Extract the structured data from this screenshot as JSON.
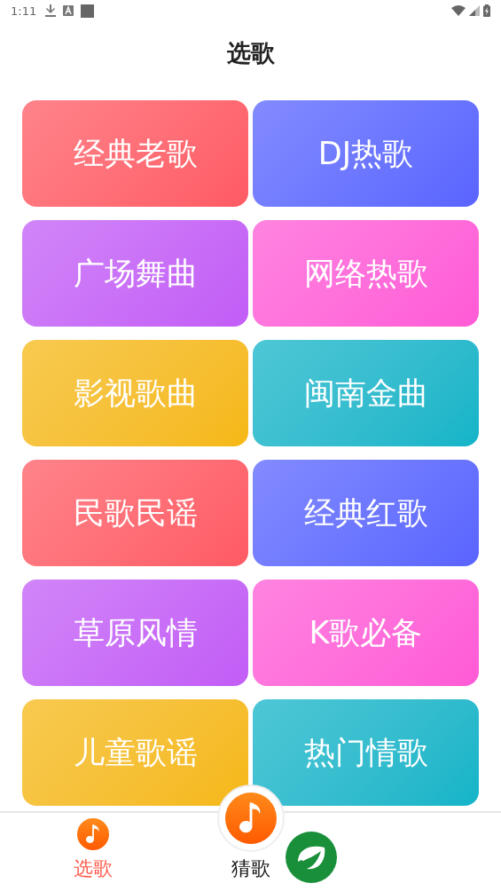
{
  "status_bar": {
    "time": "1:11"
  },
  "title": "选歌",
  "tiles": [
    {
      "label": "经典老歌",
      "color": "#ff5a64"
    },
    {
      "label": "DJ热歌",
      "color": "#5a64ff"
    },
    {
      "label": "广场舞曲",
      "color": "#c25cf6"
    },
    {
      "label": "网络热歌",
      "color": "#ff5ad6"
    },
    {
      "label": "影视歌曲",
      "color": "#f5b814"
    },
    {
      "label": "闽南金曲",
      "color": "#12b4c8"
    },
    {
      "label": "民歌民谣",
      "color": "#ff5a64"
    },
    {
      "label": "经典红歌",
      "color": "#5a64ff"
    },
    {
      "label": "草原风情",
      "color": "#c25cf6"
    },
    {
      "label": "K歌必备",
      "color": "#ff5ad6"
    },
    {
      "label": "儿童歌谣",
      "color": "#f5b814"
    },
    {
      "label": "热门情歌",
      "color": "#12b4c8"
    }
  ],
  "nav": [
    {
      "label": "选歌",
      "selected": true,
      "kind": "tab"
    },
    {
      "label": "猜歌",
      "selected": false,
      "kind": "center"
    }
  ]
}
